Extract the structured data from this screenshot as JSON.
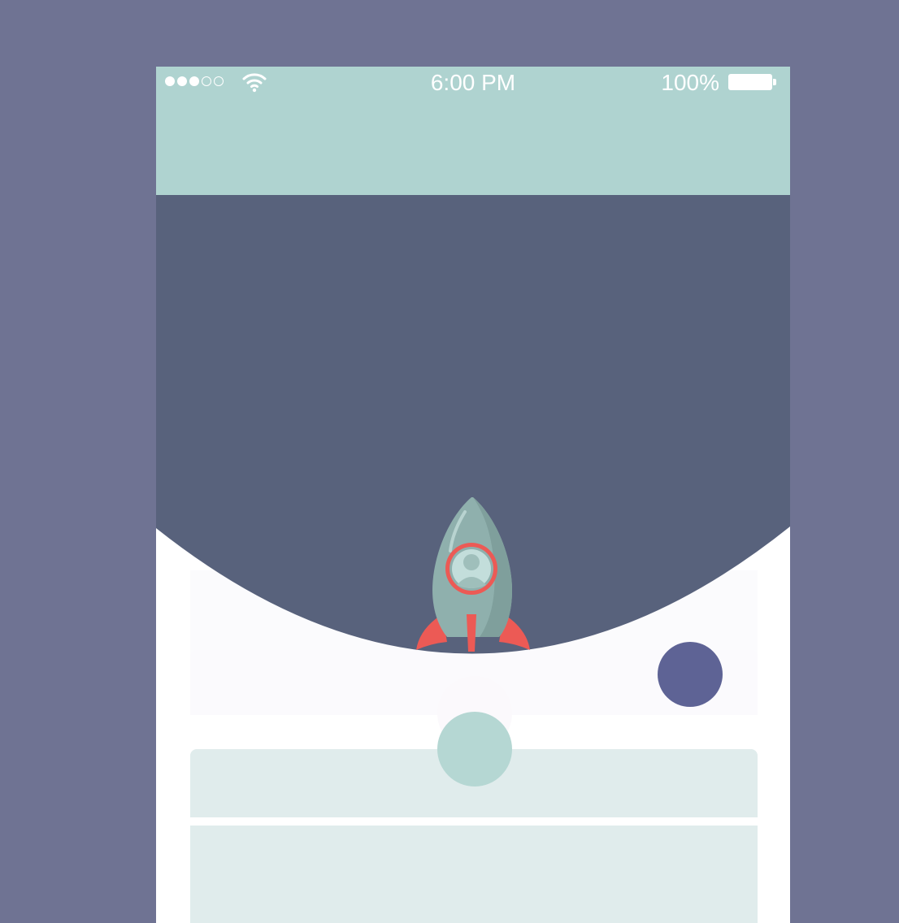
{
  "status_bar": {
    "time": "6:00 PM",
    "battery_percent": "100%",
    "signal_bars_filled": 3,
    "signal_bars_total": 5,
    "wifi_icon": "wifi-icon",
    "battery_icon": "battery-full-icon"
  },
  "illustration": {
    "rocket_icon": "rocket-icon",
    "avatar_icon": "user-avatar-icon"
  },
  "colors": {
    "background": "#6f7393",
    "header": "#afd3d0",
    "dark_panel": "#58627c",
    "accent_red": "#ec5a55",
    "teal_circle": "#b5d7d3",
    "navy_circle": "#5e6395",
    "card_light": "#e0ecec"
  }
}
